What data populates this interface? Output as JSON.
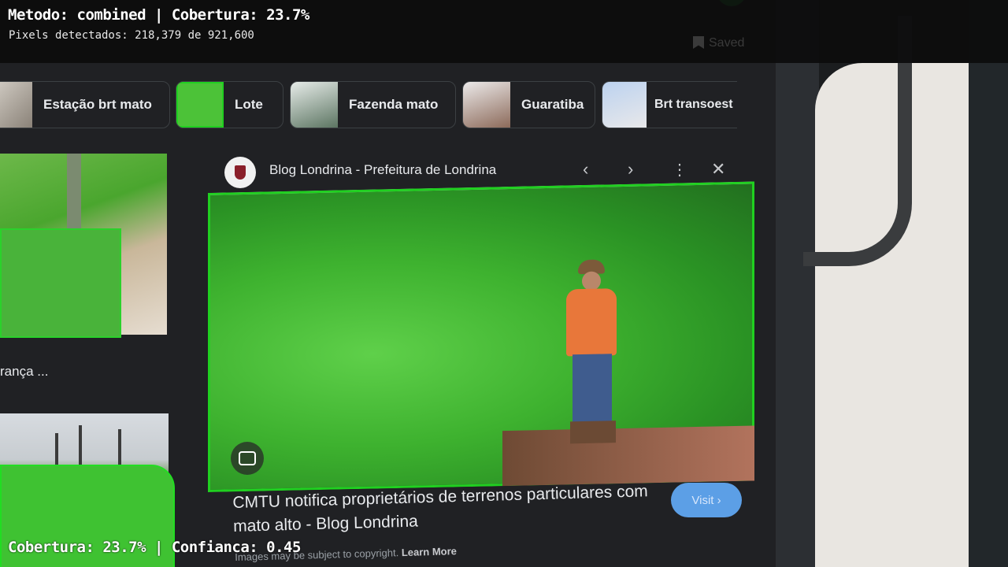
{
  "overlay": {
    "title": "Metodo: combined | Cobertura: 23.7%",
    "pixels": "Pixels detectados: 218,379 de 921,600",
    "bottom": "Cobertura: 23.7% | Confianca: 0.45"
  },
  "saved_label": "Saved",
  "chips": [
    {
      "label": "Estação brt mato"
    },
    {
      "label": "Lote"
    },
    {
      "label": "Fazenda mato"
    },
    {
      "label": "Guaratiba"
    },
    {
      "label": "Brt transoest"
    }
  ],
  "left": {
    "caption": "rança ..."
  },
  "panel": {
    "site": "Blog Londrina - Prefeitura de Londrina",
    "headline": "CMTU notifica proprietários de terrenos particulares com mato alto - Blog Londrina",
    "visit": "Visit",
    "copyright": "Images may be subject to copyright.",
    "learn_more": "Learn More"
  },
  "colors": {
    "detection_outline": "#20d020",
    "visit_button": "#5c9fe6"
  }
}
